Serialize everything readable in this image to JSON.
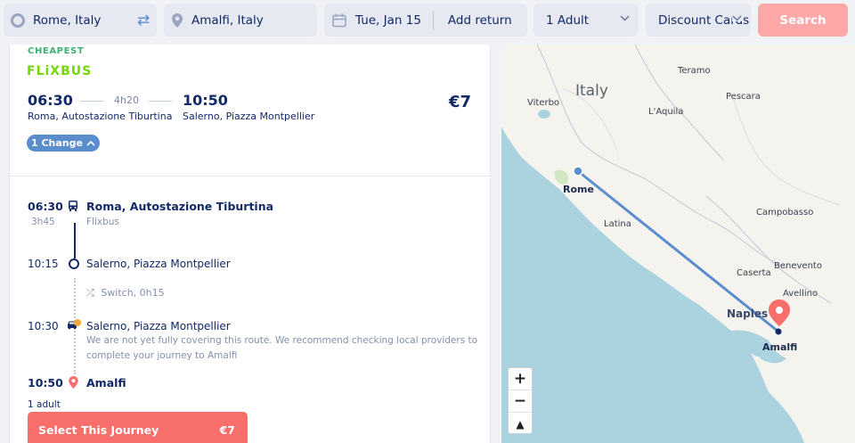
{
  "search": {
    "from": "Rome, Italy",
    "to": "Amalfi, Italy",
    "date": "Tue, Jan 15",
    "return_label": "Add return",
    "passengers": "1 Adult",
    "discount": "Discount Cards",
    "search_label": "Search"
  },
  "trip": {
    "badge": "CHEAPEST",
    "operator_logo": "FLiXBUS",
    "departure_time": "06:30",
    "arrival_time": "10:50",
    "duration": "4h20",
    "price": "€7",
    "departure_station": "Roma, Autostazione Tiburtina",
    "arrival_station": "Salerno, Piazza Montpellier",
    "changes_label": "1 Change"
  },
  "itinerary": {
    "seg1_time": "06:30",
    "seg1_station": "Roma, Autostazione Tiburtina",
    "seg1_duration": "3h45",
    "seg1_operator": "Flixbus",
    "seg2_time": "10:15",
    "seg2_station": "Salerno, Piazza Montpellier",
    "switch_text": "Switch, 0h15",
    "seg3_time": "10:30",
    "seg3_station": "Salerno, Piazza Montpellier",
    "seg3_note_1": "We are not yet fully covering this route. We recommend checking local providers to",
    "seg3_note_2": "complete your journey to Amalfi",
    "seg4_time": "10:50",
    "seg4_station": "Amalfi",
    "adults": "1 adult",
    "select_label": "Select This Journey",
    "select_price": "€7"
  },
  "map": {
    "country": "Italy",
    "labels": {
      "teramo": "Teramo",
      "viterbo": "Viterbo",
      "pescara": "Pescara",
      "laquila": "L'Aquila",
      "rome": "Rome",
      "latina": "Latina",
      "campobasso": "Campobasso",
      "benevento": "Benevento",
      "caserta": "Caserta",
      "avellino": "Avellino",
      "naples": "Naples",
      "amalfi": "Amalfi"
    },
    "zoom_in": "+",
    "zoom_out": "−",
    "compass": "▲"
  },
  "colors": {
    "accent_blue": "#5b8dcc",
    "search_button": "#fda8a6",
    "select_button": "#f76e6b",
    "cheapest_green": "#3fae73",
    "flixbus_green": "#73d700",
    "text_navy": "#132968"
  }
}
